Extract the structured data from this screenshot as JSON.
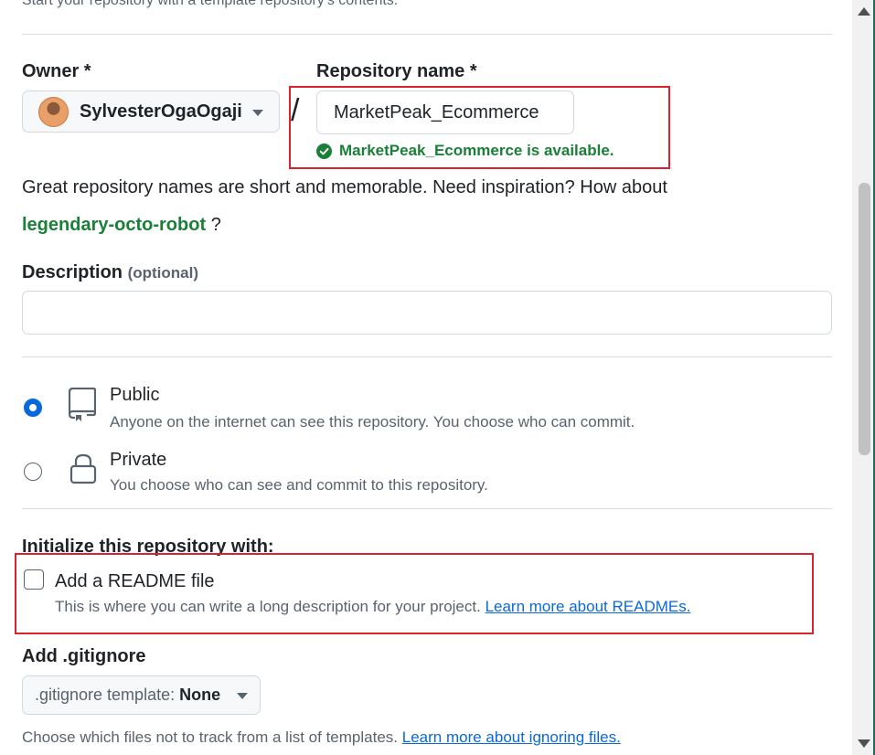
{
  "template_section": {
    "hint_text": "Start your repository with a template repository's contents."
  },
  "owner": {
    "label": "Owner *",
    "selected": "SylvesterOgaOgaji"
  },
  "separator": "/",
  "repository": {
    "label": "Repository name *",
    "value": "MarketPeak_Ecommerce",
    "availability": "MarketPeak_Ecommerce is available."
  },
  "name_hint": {
    "text": "Great repository names are short and memorable. Need inspiration? How about",
    "suggestion": "legendary-octo-robot",
    "suffix": "?"
  },
  "description": {
    "label": "Description",
    "optional": "(optional)",
    "value": ""
  },
  "visibility": {
    "options": [
      {
        "title": "Public",
        "desc": "Anyone on the internet can see this repository. You choose who can commit.",
        "selected": true,
        "icon": "repo-icon"
      },
      {
        "title": "Private",
        "desc": "You choose who can see and commit to this repository.",
        "selected": false,
        "icon": "lock-icon"
      }
    ]
  },
  "initialize": {
    "heading": "Initialize this repository with:",
    "readme_label": "Add a README file",
    "readme_desc": "This is where you can write a long description for your project.",
    "readme_link": "Learn more about READMEs.",
    "readme_checked": false
  },
  "gitignore": {
    "label": "Add .gitignore",
    "button_prefix": ".gitignore template: ",
    "button_value": "None",
    "desc": "Choose which files not to track from a list of templates.",
    "link": "Learn more about ignoring files."
  },
  "colors": {
    "success": "#1a7f37",
    "accent": "#0969da",
    "highlight": "#d9232e"
  }
}
